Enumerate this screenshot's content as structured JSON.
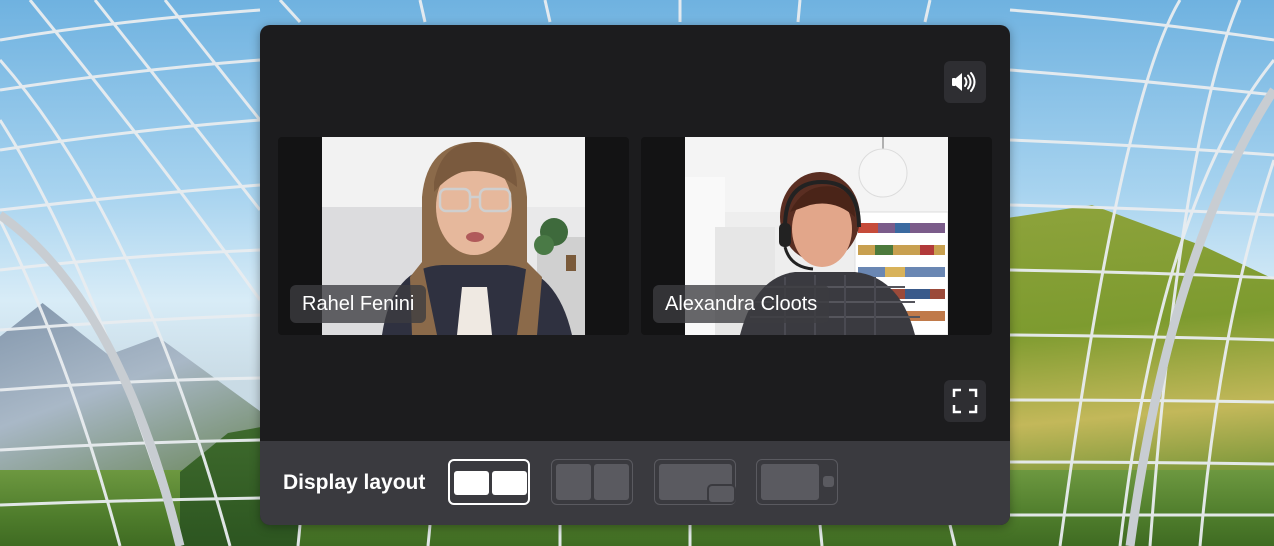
{
  "panel": {
    "audio_icon": "speaker-volume-icon",
    "fullscreen_icon": "fullscreen-icon"
  },
  "participants": [
    {
      "name": "Rahel Fenini"
    },
    {
      "name": "Alexandra Cloots"
    }
  ],
  "layout_bar": {
    "label": "Display layout",
    "options": [
      {
        "id": "side-by-side-tiles",
        "selected": true
      },
      {
        "id": "split-screen",
        "selected": false
      },
      {
        "id": "picture-in-picture",
        "selected": false
      },
      {
        "id": "main-with-thumbnail",
        "selected": false
      }
    ]
  },
  "colors": {
    "panel_bg": "#1c1c1e",
    "bar_bg": "#3a3a3f",
    "button_bg": "#2e2e32",
    "accent_selected": "#ffffff"
  }
}
